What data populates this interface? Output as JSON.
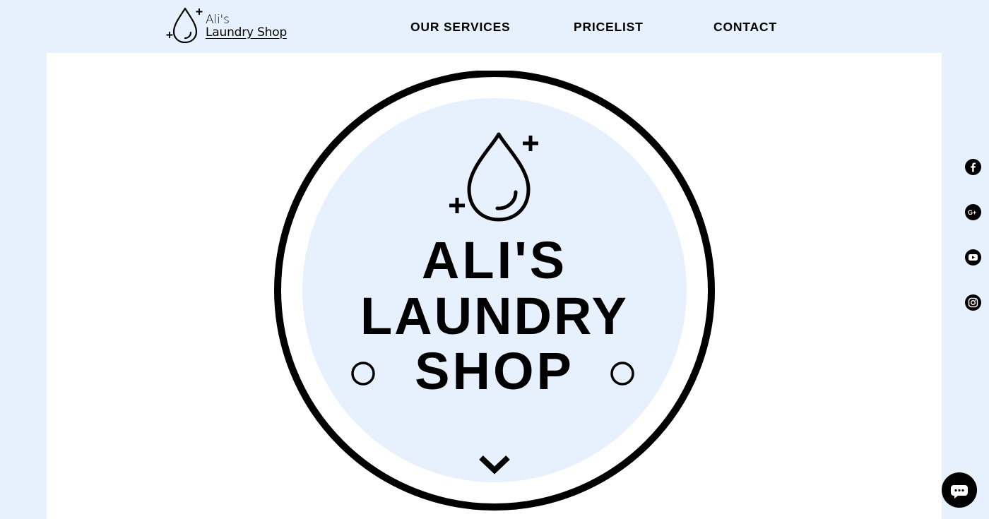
{
  "header": {
    "logo": {
      "line1": "Ali's",
      "line2": "Laundry Shop",
      "icon": "water-drop-icon"
    },
    "nav": {
      "services": "OUR SERVICES",
      "pricelist": "PRICELIST",
      "contact": "CONTACT"
    }
  },
  "hero": {
    "title_line1": "ALI'S",
    "title_line2": "LAUNDRY",
    "title_line3": "SHOP",
    "icon": "water-drop-icon",
    "scroll_icon": "chevron-down-icon"
  },
  "social": [
    {
      "icon": "facebook-icon"
    },
    {
      "icon": "google-plus-icon"
    },
    {
      "icon": "youtube-icon"
    },
    {
      "icon": "instagram-icon"
    }
  ],
  "chat": {
    "icon": "chat-bubble-icon"
  },
  "colors": {
    "page_background": "#e7f1fd",
    "panel_background": "#ffffff",
    "badge_fill": "#e7f1fd",
    "ink": "#000000"
  }
}
